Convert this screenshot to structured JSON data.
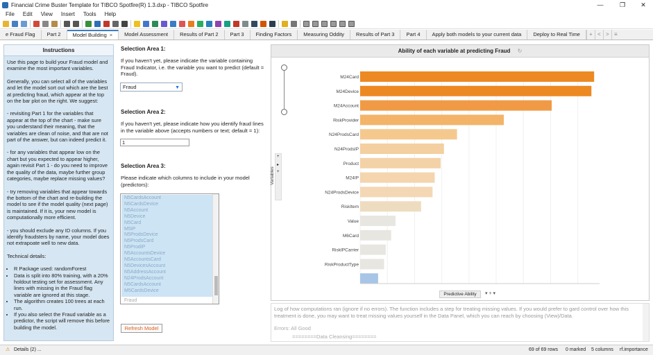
{
  "window": {
    "title": "Financial Crime Buster Template for TIBCO Spotfire(R) 1.3.dxp - TIBCO Spotfire",
    "minimize": "—",
    "maximize": "❐",
    "close": "✕"
  },
  "menu": [
    "File",
    "Edit",
    "View",
    "Insert",
    "Tools",
    "Help"
  ],
  "tabs": [
    {
      "label": "e Fraud Flag"
    },
    {
      "label": "Part 2"
    },
    {
      "label": "Model Building",
      "active": true
    },
    {
      "label": "Model Assessment"
    },
    {
      "label": "Results of Part 2"
    },
    {
      "label": "Part 3"
    },
    {
      "label": "Finding Factors"
    },
    {
      "label": "Measuring Oddity"
    },
    {
      "label": "Results of Part 3"
    },
    {
      "label": "Part 4"
    },
    {
      "label": "Apply both models to your current data"
    },
    {
      "label": "Deploy to Real Time"
    }
  ],
  "tab_nav": {
    "add": "+",
    "prev": "<",
    "next": ">",
    "menu": "≡"
  },
  "tab_close": "×",
  "instructions": {
    "header": "Instructions",
    "paragraphs": [
      "Use this page to build your Fraud model and examine the most important variables.",
      "Generally, you can select all of the variables and let the model sort out which are the best at predicting fraud, which appear at the top on the bar plot on the right. We suggest:",
      "- revisiting Part 1 for the variables that appear at the top of the chart - make sure you understand their meaning, that the variables are clean of noise, and that are not part of the answer, but can indeed predict it.",
      "- for any variables that appear low on the chart but you expected to appear higher, again revisit Part 1 - do you need to improve the quality of the data, maybe further group categories, maybe replace missing values?",
      "- try removing variables that appear towards the bottom of the chart and re-building the model to see if the model quality (next page) is maintained. If it is, your new model is computationally more efficient.",
      "- you should exclude any ID columns. If you identify fraudsters by name, your model does not extrapoate well to new data.",
      "Technical details:"
    ],
    "bullets": [
      "R Package used: randomForest",
      "Data is split into 80% training, with a 20% holdout testing set for assessment. Any lines with missing in the Fraud flag variable are ignored at this stage.",
      "The algorithm creates 100 trees at each run.",
      "If you also select the Fraud variable as a predictor, the script will remove this before building the model."
    ]
  },
  "selection": {
    "area1_title": "Selection Area 1:",
    "area1_text": "If you haven't yet, please indicate the variable containing Fraud Indicator, i.e. the variable you want to predict (default = Fraud).",
    "area1_value": "Fraud",
    "area2_title": "Selection Area 2:",
    "area2_text": "If you haven't yet, please indicate how you identify fraud lines in the variable above (accepts numbers or text; default = 1):",
    "area2_value": "1",
    "area3_title": "Selection Area 3:",
    "area3_text": "Please indicate which columns to include in your model (predictors):",
    "columns": [
      "N5CardsAccount",
      "N5CardsDevice",
      "N5Account",
      "N5Device",
      "N5Card",
      "M5IP",
      "N5ProdsDevice",
      "N5ProdsCard",
      "N5ProdIP",
      "N5AccountsDevice",
      "N5AccountsCard",
      "N5DevicesAccount",
      "N5AddressAccount",
      "N24ProdsAccount",
      "N5CardsAccount",
      "M5CardsDevice"
    ],
    "last_item": "Fraud",
    "refresh_label": "Refresh Model"
  },
  "chart_panel": {
    "title": "Ability of each variable at predicting Fraud",
    "refresh_icon": "↻",
    "yaxis_label": "Variables",
    "xaxis_button": "Predictive Ability",
    "xaxis_controls": "▾  +  ▾",
    "axis_ctl": [
      "+",
      "▸",
      "+"
    ]
  },
  "chart_data": {
    "type": "bar",
    "orientation": "horizontal",
    "title": "Ability of each variable at predicting Fraud",
    "xlabel": "Predictive Ability",
    "ylabel": "Variables",
    "xlim": [
      0,
      440
    ],
    "xticks": [
      0,
      50,
      100,
      150,
      200,
      250,
      300,
      350,
      400
    ],
    "categories": [
      "M24Card",
      "M24Device",
      "M24Account",
      "RiskProvider",
      "N24ProdsCard",
      "N24ProdsIP",
      "Product",
      "M24IP",
      "N24ProdsDevice",
      "RiskItem",
      "Value",
      "M6Card",
      "RiskIPCarrier",
      "RiskProductType",
      ""
    ],
    "values": [
      430,
      425,
      352,
      264,
      178,
      154,
      148,
      137,
      133,
      112,
      65,
      57,
      47,
      44,
      33
    ],
    "colors": [
      "#ed8923",
      "#ed8923",
      "#f09a46",
      "#f3b469",
      "#f5c98e",
      "#f4cfa0",
      "#f4d2a7",
      "#f4d5ae",
      "#f4d7b4",
      "#eedcc1",
      "#e8e6e1",
      "#e8e6e1",
      "#e8e6e1",
      "#e8e6e1",
      "#a7c5e6"
    ]
  },
  "log": {
    "text": "Log of how computations ran (ignore if no errors). The function includes a step for treating missing values. If you would prefer to gard control over how this treatment is done, you may want to treat missing values yourself in the Data Panel, which you can reach by choosing (View)/Data.",
    "errors": "Errors: All Good",
    "data_cleansing": "========Data Cleansing========"
  },
  "status": {
    "details": "Details (2) ...",
    "rows": "69 of 69 rows",
    "marked": "0 marked",
    "columns": "5 columns",
    "table": "rf.importance"
  }
}
